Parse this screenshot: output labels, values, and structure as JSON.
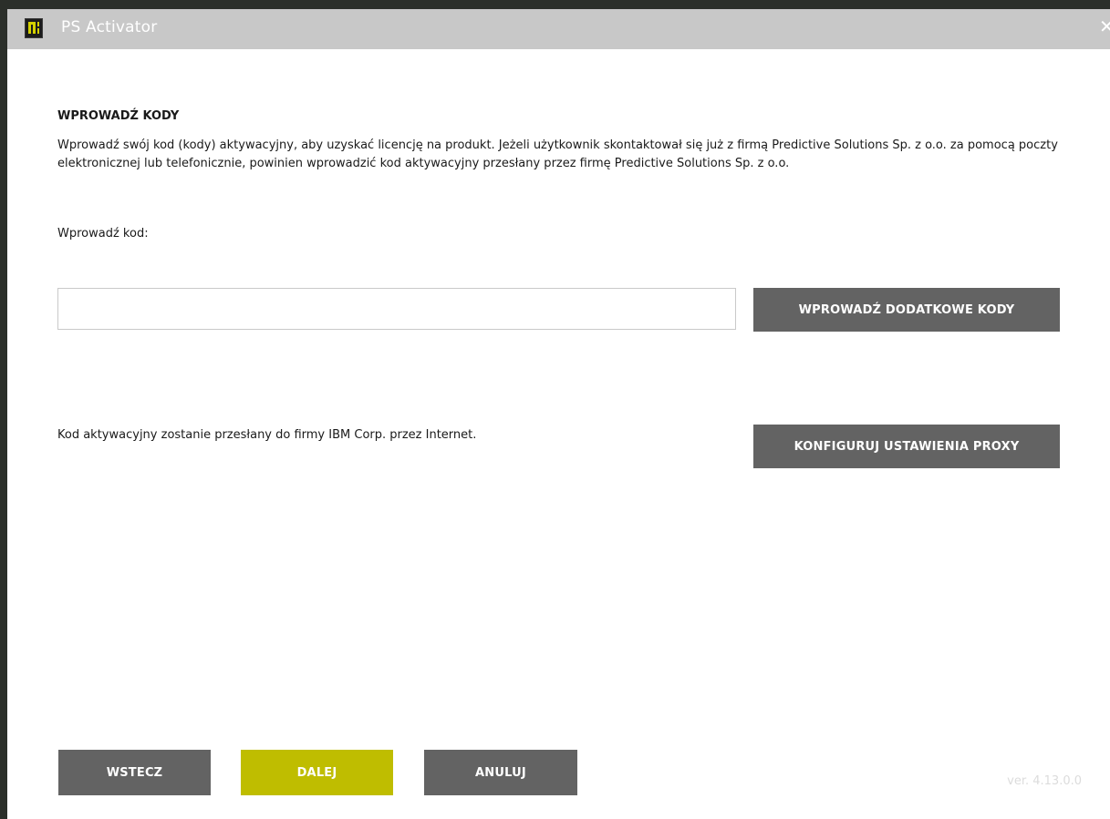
{
  "window": {
    "title": "PS Activator",
    "close_glyph": "✕"
  },
  "content": {
    "heading": "WPROWADŹ KODY",
    "description": "Wprowadź swój kod (kody) aktywacyjny, aby uzyskać licencję na produkt. Jeżeli użytkownik skontaktował się już z firmą Predictive Solutions Sp. z o.o. za pomocą poczty elektronicznej lub telefonicznie, powinien wprowadzić kod aktywacyjny przesłany przez firmę Predictive Solutions Sp. z o.o.",
    "code_label": "Wprowadź kod:",
    "code_value": "",
    "more_codes_button": "WPROWADŹ DODATKOWE KODY",
    "internet_notice": "Kod aktywacyjny zostanie przesłany do firmy IBM Corp. przez Internet.",
    "proxy_button": "KONFIGURUJ USTAWIENIA PROXY"
  },
  "footer": {
    "back_button": "WSTECZ",
    "next_button": "DALEJ",
    "cancel_button": "ANULUJ",
    "version": "ver. 4.13.0.0"
  },
  "colors": {
    "titlebar": "#c8c8c8",
    "button_gray": "#636363",
    "button_accent": "#bfbd00",
    "icon_accent": "#d4d100"
  },
  "icons": {
    "app": "app-logo-icon",
    "close": "close-icon"
  }
}
